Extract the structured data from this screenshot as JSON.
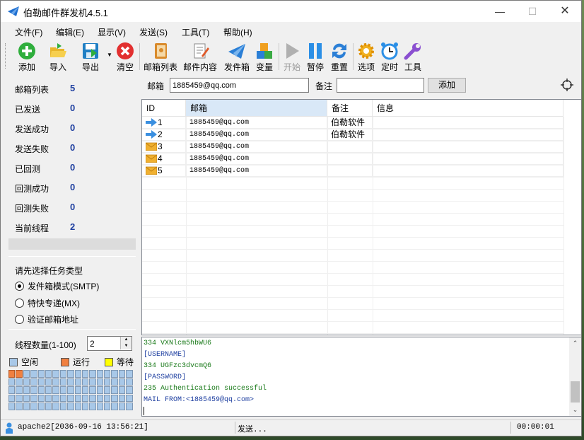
{
  "window": {
    "title": "伯勒邮件群发机4.5.1"
  },
  "menu": [
    "文件(F)",
    "编辑(E)",
    "显示(V)",
    "发送(S)",
    "工具(T)",
    "帮助(H)"
  ],
  "toolbar": {
    "add": "添加",
    "import": "导入",
    "export": "导出",
    "clear": "清空",
    "mailbox_list": "邮箱列表",
    "mail_content": "邮件内容",
    "outbox": "发件箱",
    "variables": "变量",
    "start": "开始",
    "pause": "暂停",
    "reset": "重置",
    "options": "选项",
    "timer": "定时",
    "tools": "工具"
  },
  "stats": [
    {
      "label": "邮箱列表",
      "value": "5"
    },
    {
      "label": "已发送",
      "value": "0"
    },
    {
      "label": "发送成功",
      "value": "0"
    },
    {
      "label": "发送失败",
      "value": "0"
    },
    {
      "label": "已回测",
      "value": "0"
    },
    {
      "label": "回测成功",
      "value": "0"
    },
    {
      "label": "回测失败",
      "value": "0"
    },
    {
      "label": "当前线程",
      "value": "2"
    }
  ],
  "task": {
    "title": "请先选择任务类型",
    "options": [
      "发件箱模式(SMTP)",
      "特快专递(MX)",
      "验证邮箱地址"
    ],
    "selected": 0
  },
  "threads": {
    "label": "线程数量(1-100)",
    "value": "2"
  },
  "legend": {
    "idle": "空闲",
    "running": "运行",
    "waiting": "等待",
    "colors": {
      "idle": "#a8c8e8",
      "running": "#f08040",
      "waiting": "#ffff00"
    }
  },
  "thread_grid": {
    "total": 85,
    "running": 2
  },
  "form": {
    "email_label": "邮箱",
    "email_value": "1885459@qq.com",
    "note_label": "备注",
    "note_value": "",
    "add_button": "添加"
  },
  "table": {
    "headers": [
      "ID",
      "邮箱",
      "备注",
      "信息"
    ],
    "rows": [
      {
        "status": "sending",
        "id": "1",
        "email": "1885459@qq.com",
        "note": "伯勒软件",
        "info": ""
      },
      {
        "status": "sending",
        "id": "2",
        "email": "1885459@qq.com",
        "note": "伯勒软件",
        "info": ""
      },
      {
        "status": "pending",
        "id": "3",
        "email": "1885459@qq.com",
        "note": "",
        "info": ""
      },
      {
        "status": "pending",
        "id": "4",
        "email": "1885459@qq.com",
        "note": "",
        "info": ""
      },
      {
        "status": "pending",
        "id": "5",
        "email": "1885459@qq.com",
        "note": "",
        "info": ""
      }
    ]
  },
  "log": [
    {
      "text": "334 VXNlcm5hbWU6",
      "color": "#1a7a1a"
    },
    {
      "text": "[USERNAME]",
      "color": "#1e3fa0"
    },
    {
      "text": "334 UGFzc3dvcmQ6",
      "color": "#1a7a1a"
    },
    {
      "text": "[PASSWORD]",
      "color": "#1e3fa0"
    },
    {
      "text": "235 Authentication successful",
      "color": "#1a7a1a"
    },
    {
      "text": "MAIL FROM:<1885459@qq.com>",
      "color": "#1e3fa0"
    }
  ],
  "status": {
    "user": "apache2[2036-09-16 13:56:21]",
    "message": "发送...",
    "elapsed": "00:00:01"
  }
}
